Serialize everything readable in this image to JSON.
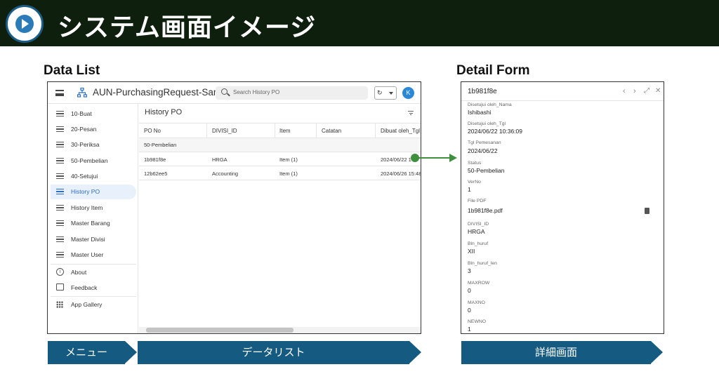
{
  "page": {
    "title": "システム画面イメージ",
    "left_label": "Data List",
    "right_label": "Detail Form"
  },
  "app": {
    "title": "AUN-PurchasingRequest-Sample",
    "search_placeholder": "Search History PO",
    "sync_label": "↻",
    "avatar": "K",
    "sidebar": {
      "items": [
        {
          "label": "10-Buat",
          "icon": "list-icon"
        },
        {
          "label": "20-Pesan",
          "icon": "list-icon"
        },
        {
          "label": "30-Periksa",
          "icon": "list-icon"
        },
        {
          "label": "50-Pembelian",
          "icon": "list-icon"
        },
        {
          "label": "40-Setujui",
          "icon": "list-icon"
        },
        {
          "label": "History PO",
          "icon": "list-icon",
          "active": true
        },
        {
          "label": "History Item",
          "icon": "list-icon"
        },
        {
          "label": "Master Barang",
          "icon": "list-icon"
        },
        {
          "label": "Master Divisi",
          "icon": "list-icon"
        },
        {
          "label": "Master User",
          "icon": "list-icon"
        }
      ],
      "about": "About",
      "feedback": "Feedback",
      "gallery": "App Gallery"
    },
    "main": {
      "title": "History PO",
      "columns": [
        "PO No",
        "DIVISI_ID",
        "Item",
        "Catatan",
        "Dibuat oleh_Tgl"
      ],
      "group": "50-Pembelian",
      "rows": [
        [
          "1b981f8e",
          "HRGA",
          "Item (1)",
          "",
          "2024/06/22 1"
        ],
        [
          "12b62ee5",
          "Accounting",
          "Item (1)",
          "",
          "2024/06/26 15:48"
        ]
      ]
    }
  },
  "detail": {
    "title": "1b981f8e",
    "fields": [
      {
        "label": "Disetujui oleh_Nama",
        "value": "Ishibashi"
      },
      {
        "label": "Disetujui oleh_Tgl",
        "value": "2024/06/22 10:36:09"
      },
      {
        "label": "Tgl Pemesanan",
        "value": "2024/06/22"
      },
      {
        "label": "Status",
        "value": "50-Pembelian"
      },
      {
        "label": "VerNo",
        "value": "1"
      },
      {
        "label": "File PDF",
        "value": "1b981f8e.pdf"
      },
      {
        "label": "DIVISI_ID",
        "value": "HRGA"
      },
      {
        "label": "Bln_huruf",
        "value": "XII"
      },
      {
        "label": "Bln_huruf_len",
        "value": "3"
      },
      {
        "label": "MAXROW",
        "value": "0"
      },
      {
        "label": "MAXNO",
        "value": "0"
      },
      {
        "label": "NEWNO",
        "value": "1"
      }
    ],
    "icons": [
      "chevron-left-icon",
      "chevron-right-icon",
      "expand-icon",
      "close-icon"
    ]
  },
  "ribbons": {
    "menu": "メニュー",
    "data_list": "データリスト",
    "detail": "詳細画面"
  },
  "colors": {
    "header_bg": "#0e1f0e",
    "ribbon_bg": "#155a80",
    "arrow": "#3f8f3f",
    "accent": "#2b6cc4"
  }
}
